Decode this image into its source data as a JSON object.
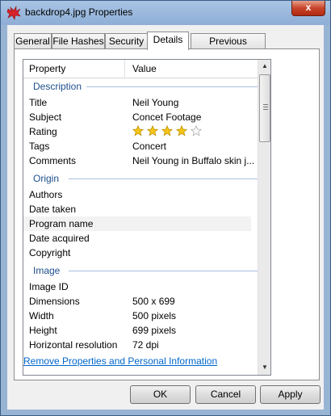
{
  "window": {
    "title": "backdrop4.jpg Properties",
    "close_glyph": "x"
  },
  "tabs": [
    {
      "label": "General"
    },
    {
      "label": "File Hashes"
    },
    {
      "label": "Security"
    },
    {
      "label": "Details",
      "active": true
    },
    {
      "label": "Previous Versions"
    }
  ],
  "details": {
    "columns": {
      "property": "Property",
      "value": "Value"
    },
    "groups": {
      "description": {
        "label": "Description",
        "rows": [
          {
            "property": "Title",
            "value": "Neil Young"
          },
          {
            "property": "Subject",
            "value": "Concet Footage"
          },
          {
            "property": "Rating",
            "rating": 4,
            "rating_max": 5
          },
          {
            "property": "Tags",
            "value": "Concert"
          },
          {
            "property": "Comments",
            "value": "Neil Young in Buffalo skin j..."
          }
        ]
      },
      "origin": {
        "label": "Origin",
        "rows": [
          {
            "property": "Authors",
            "value": ""
          },
          {
            "property": "Date taken",
            "value": ""
          },
          {
            "property": "Program name",
            "value": "",
            "selected": true
          },
          {
            "property": "Date acquired",
            "value": ""
          },
          {
            "property": "Copyright",
            "value": ""
          }
        ]
      },
      "image": {
        "label": "Image",
        "rows": [
          {
            "property": "Image ID",
            "value": ""
          },
          {
            "property": "Dimensions",
            "value": "500 x 699"
          },
          {
            "property": "Width",
            "value": "500 pixels"
          },
          {
            "property": "Height",
            "value": "699 pixels"
          },
          {
            "property": "Horizontal resolution",
            "value": "72 dpi"
          }
        ]
      }
    }
  },
  "link": {
    "label": "Remove Properties and Personal Information"
  },
  "buttons": {
    "ok": "OK",
    "cancel": "Cancel",
    "apply": "Apply"
  },
  "icons": {
    "window_icon": "camera-icon",
    "star_filled": "star-filled-icon",
    "star_empty": "star-empty-icon"
  },
  "colors": {
    "titlebar": "#98b4d4",
    "group_label": "#1e4e8c",
    "link": "#0066cc",
    "star": "#f5c518"
  }
}
